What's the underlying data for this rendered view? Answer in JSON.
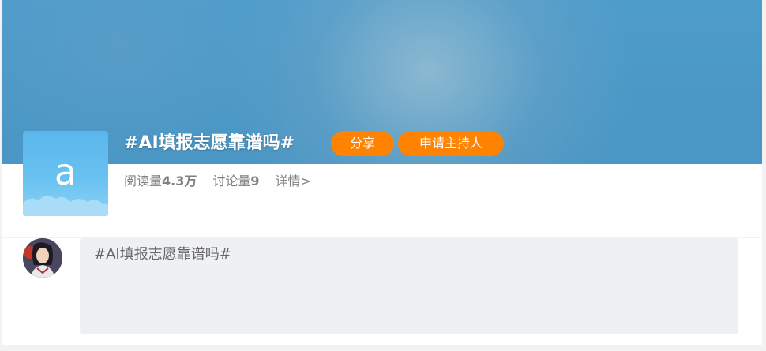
{
  "topic": {
    "avatar_letter": "a",
    "title": "#AI填报志愿靠谱吗#",
    "share_label": "分享",
    "apply_host_label": "申请主持人",
    "stats": {
      "reads_label": "阅读量",
      "reads_value": "4.3万",
      "discussions_label": "讨论量",
      "discussions_value": "9",
      "details_label": "详情>"
    }
  },
  "composer": {
    "text": "#AI填报志愿靠谱吗#"
  },
  "colors": {
    "banner": "#4a96c4",
    "accent_button": "#ff8200",
    "avatar_bg": "#5bb6ec",
    "composer_bg": "#eff0f4"
  },
  "icons": {
    "topic_avatar": "letter-a-cloud-icon",
    "user_avatar": "user-photo-avatar"
  }
}
